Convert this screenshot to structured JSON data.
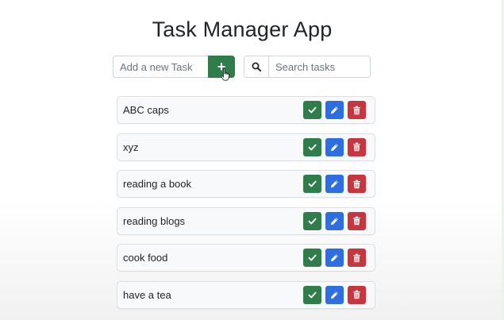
{
  "app": {
    "title": "Task Manager App"
  },
  "add_task": {
    "placeholder": "Add a new Task",
    "button_label": "+"
  },
  "search": {
    "placeholder": "Search tasks",
    "icon": "search-icon"
  },
  "actions": {
    "complete_icon": "check-icon",
    "edit_icon": "pencil-icon",
    "delete_icon": "trash-icon"
  },
  "colors": {
    "success": "#2e7d4a",
    "primary": "#2f6ee0",
    "danger": "#c6363f"
  },
  "tasks": [
    {
      "text": "ABC caps"
    },
    {
      "text": "xyz"
    },
    {
      "text": "reading a book"
    },
    {
      "text": "reading blogs"
    },
    {
      "text": "cook food"
    },
    {
      "text": "have a tea"
    }
  ]
}
